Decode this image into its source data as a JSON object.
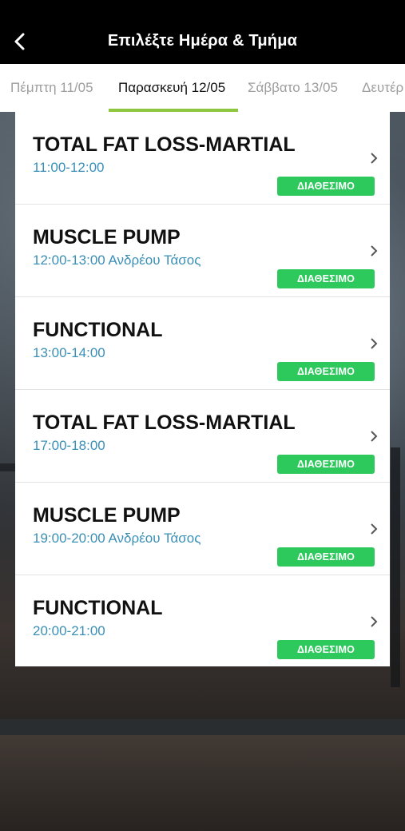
{
  "header": {
    "title": "Επιλέξτε Ημέρα & Τμήμα"
  },
  "tabs": [
    {
      "label": "Πέμπτη 11/05",
      "active": false
    },
    {
      "label": "Παρασκευή 12/05",
      "active": true
    },
    {
      "label": "Σάββατο 13/05",
      "active": false
    },
    {
      "label": "Δευτέρ",
      "active": false
    }
  ],
  "classes": [
    {
      "title": "TOTAL FAT LOSS-MARTIAL",
      "subtitle": "11:00-12:00",
      "status": "ΔΙΑΘΕΣΙΜΟ"
    },
    {
      "title": "MUSCLE PUMP",
      "subtitle": "12:00-13:00 Ανδρέου Τάσος",
      "status": "ΔΙΑΘΕΣΙΜΟ"
    },
    {
      "title": "FUNCTIONAL",
      "subtitle": "13:00-14:00",
      "status": "ΔΙΑΘΕΣΙΜΟ"
    },
    {
      "title": "TOTAL FAT LOSS-MARTIAL",
      "subtitle": "17:00-18:00",
      "status": "ΔΙΑΘΕΣΙΜΟ"
    },
    {
      "title": "MUSCLE PUMP",
      "subtitle": "19:00-20:00 Ανδρέου Τάσος",
      "status": "ΔΙΑΘΕΣΙΜΟ"
    },
    {
      "title": "FUNCTIONAL",
      "subtitle": "20:00-21:00",
      "status": "ΔΙΑΘΕΣΙΜΟ"
    }
  ],
  "colors": {
    "accent": "#8dc63f",
    "badge": "#2ec95c",
    "time_text": "#3a8fb7",
    "header_bg": "#000000"
  },
  "icons": {
    "back": "arrow-left-icon",
    "row": "chevron-right-icon"
  }
}
